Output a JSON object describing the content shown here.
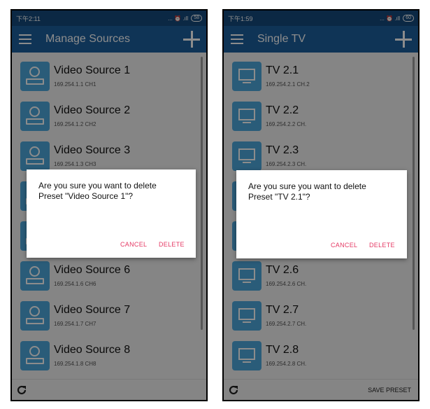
{
  "left": {
    "status": {
      "time": "下午2:11",
      "icons": "... ⏰ .ıll",
      "battery": "58"
    },
    "appbar": {
      "title": "Manage Sources"
    },
    "items": [
      {
        "title": "Video Source 1",
        "sub": "169.254.1.1  CH1"
      },
      {
        "title": "Video Source 2",
        "sub": "169.254.1.2  CH2"
      },
      {
        "title": "Video Source 3",
        "sub": "169.254.1.3  CH3"
      },
      {
        "title": "Video Source 6",
        "sub": "169.254.1.6  CH6"
      },
      {
        "title": "Video Source 7",
        "sub": "169.254.1.7  CH7"
      },
      {
        "title": "Video Source 8",
        "sub": "169.254.1.8  CH8"
      }
    ],
    "dialog": {
      "line1": "Are you sure you want to delete",
      "line2": "Preset \"Video Source 1\"?",
      "cancel": "CANCEL",
      "delete": "DELETE"
    }
  },
  "right": {
    "status": {
      "time": "下午1:59",
      "icons": "... ⏰ .ıll",
      "battery": "60"
    },
    "appbar": {
      "title": "Single TV"
    },
    "items": [
      {
        "title": "TV 2.1",
        "sub": "169.254.2.1  CH.2"
      },
      {
        "title": "TV 2.2",
        "sub": "169.254.2.2  CH."
      },
      {
        "title": "TV 2.3",
        "sub": "169.254.2.3  CH."
      },
      {
        "title": "TV 2.6",
        "sub": "169.254.2.6  CH."
      },
      {
        "title": "TV 2.7",
        "sub": "169.254.2.7  CH."
      },
      {
        "title": "TV 2.8",
        "sub": "169.254.2.8  CH."
      }
    ],
    "dialog": {
      "line1": "Are you sure you want to delete",
      "line2": "Preset \"TV 2.1\"?",
      "cancel": "CANCEL",
      "delete": "DELETE"
    },
    "bottom": {
      "save_label": "SAVE PRESET"
    }
  },
  "colors": {
    "statusbar": "#14497c",
    "appbar": "#1d5f9d",
    "icon_bg": "#4ea8dc",
    "accent": "#e53964"
  }
}
